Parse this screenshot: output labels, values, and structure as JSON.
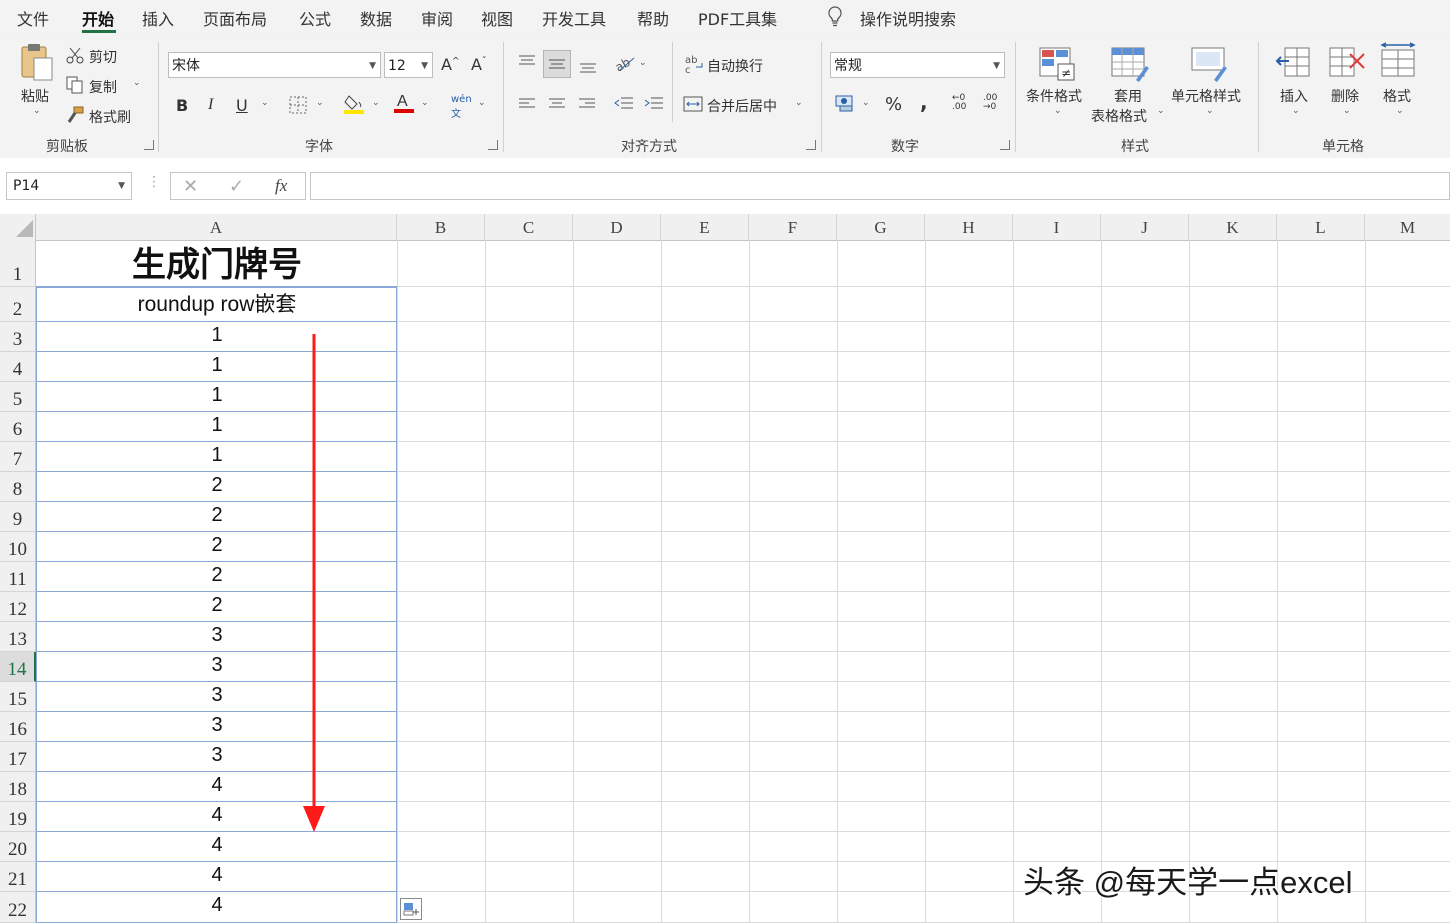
{
  "menu": {
    "items": [
      "文件",
      "开始",
      "插入",
      "页面布局",
      "公式",
      "数据",
      "审阅",
      "视图",
      "开发工具",
      "帮助",
      "PDF工具集"
    ],
    "search": "操作说明搜索"
  },
  "ribbon": {
    "clipboard": {
      "paste": "粘贴",
      "cut": "剪切",
      "copy": "复制",
      "format_painter": "格式刷",
      "group": "剪贴板"
    },
    "font": {
      "name": "宋体",
      "size": "12",
      "bold": "B",
      "italic": "I",
      "underline": "U",
      "font_color_letter": "A",
      "group": "字体",
      "font_color": "#e00000",
      "fill_color": "#ffe600"
    },
    "alignment": {
      "wrap": "自动换行",
      "merge": "合并后居中",
      "group": "对齐方式"
    },
    "number": {
      "format": "常规",
      "percent": "%",
      "comma": ",",
      "group": "数字"
    },
    "styles": {
      "cond_format": "条件格式",
      "table_format_line1": "套用",
      "table_format_line2": "表格格式",
      "cell_styles": "单元格样式",
      "group": "样式"
    },
    "cells": {
      "insert": "插入",
      "delete": "删除",
      "format": "格式",
      "group": "单元格"
    }
  },
  "formula_bar": {
    "name_box": "P14",
    "fx": "fx",
    "formula": ""
  },
  "sheet": {
    "columns": [
      "A",
      "B",
      "C",
      "D",
      "E",
      "F",
      "G",
      "H",
      "I",
      "J",
      "K",
      "L",
      "M"
    ],
    "rows": [
      "1",
      "2",
      "3",
      "4",
      "5",
      "6",
      "7",
      "8",
      "9",
      "10",
      "11",
      "12",
      "13",
      "14",
      "15",
      "16",
      "17",
      "18",
      "19",
      "20",
      "21",
      "22"
    ],
    "title": "生成门牌号",
    "header": "roundup  row嵌套",
    "values": [
      "1",
      "1",
      "1",
      "1",
      "1",
      "2",
      "2",
      "2",
      "2",
      "2",
      "3",
      "3",
      "3",
      "3",
      "3",
      "4",
      "4",
      "4",
      "4",
      "4"
    ],
    "active_row": "14"
  },
  "watermark": "头条 @每天学一点excel",
  "colors": {
    "accent": "#217346",
    "arrow": "#ff1a1a",
    "cell_border": "#8aa7d6"
  }
}
